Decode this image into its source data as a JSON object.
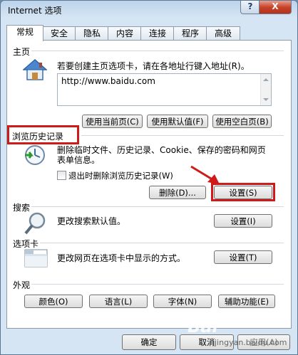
{
  "window": {
    "title": "Internet 选项",
    "help": "?",
    "close": "X"
  },
  "tabs": [
    "常规",
    "安全",
    "隐私",
    "内容",
    "连接",
    "程序",
    "高级"
  ],
  "homepage": {
    "section_title": "主页",
    "description": "若要创建主页选项卡，请在各地址行键入地址(R)。",
    "url": "http://www.baidu.com",
    "buttons": {
      "current": "使用当前页(C)",
      "default": "使用默认值(F)",
      "blank": "使用空白页(B)"
    }
  },
  "history": {
    "section_title": "浏览历史记录",
    "description_line1": "删除临时文件、历史记录、Cookie、保存的密码和网页",
    "description_line2": "表单信息。",
    "checkbox_label": "退出时删除浏览历史记录(W)",
    "checkbox_checked": false,
    "delete_button": "删除(D)...",
    "settings_button": "设置(S)"
  },
  "search": {
    "section_title": "搜索",
    "description": "更改搜索默认值。",
    "settings_button": "设置(I)"
  },
  "tabs_section": {
    "section_title": "选项卡",
    "description": "更改网页在选项卡中显示的方式。",
    "settings_button": "设置(T)"
  },
  "appearance": {
    "section_title": "外观",
    "buttons": {
      "colors": "颜色(O)",
      "languages": "语言(L)",
      "fonts": "字体(N)",
      "accessibility": "辅助功能(E)"
    }
  },
  "dialog_buttons": {
    "ok": "确定",
    "cancel": "取消",
    "apply": "应用(A)"
  },
  "watermark": {
    "text": "Bai",
    "sub": "jingyan.baidu.com"
  },
  "colors": {
    "highlight": "#d01a1a",
    "window": "#d6e5f3"
  }
}
